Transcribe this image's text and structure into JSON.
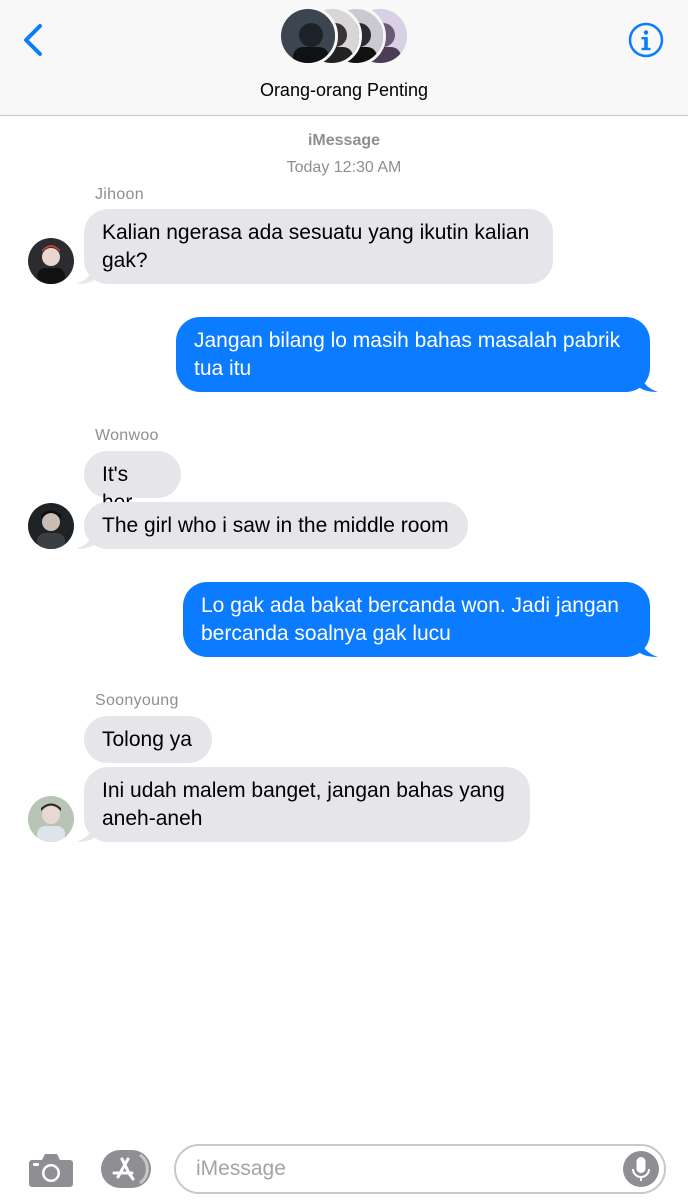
{
  "header": {
    "back_icon": "chevron-left-icon",
    "info_icon": "info-circle-icon",
    "title": "Orang-orang Penting",
    "accent": "#0b7cff"
  },
  "meta": {
    "service": "iMessage",
    "timestamp": "Today 12:30 AM"
  },
  "messages": [
    {
      "sender": "Jihoon",
      "direction": "incoming",
      "texts": [
        "Kalian ngerasa ada sesuatu yang ikutin kalian\ngak?"
      ]
    },
    {
      "direction": "outgoing",
      "texts": [
        "Jangan bilang lo masih bahas masalah pabrik\ntua itu"
      ]
    },
    {
      "sender": "Wonwoo",
      "direction": "incoming",
      "texts": [
        "It's her",
        "The girl who i saw in the middle room"
      ]
    },
    {
      "direction": "outgoing",
      "texts": [
        "Lo gak ada bakat bercanda won. Jadi jangan\nbercanda soalnya gak lucu"
      ]
    },
    {
      "sender": "Soonyoung",
      "direction": "incoming",
      "texts": [
        "Tolong ya",
        "Ini udah malem banget, jangan bahas yang\naneh-aneh"
      ]
    }
  ],
  "input": {
    "placeholder": "iMessage",
    "camera_icon": "camera-icon",
    "apps_icon": "app-store-icon",
    "mic_icon": "microphone-icon"
  },
  "colors": {
    "incoming_bubble": "#e5e5ea",
    "outgoing_bubble": "#0b7cff",
    "meta_text": "#8e8e93"
  }
}
